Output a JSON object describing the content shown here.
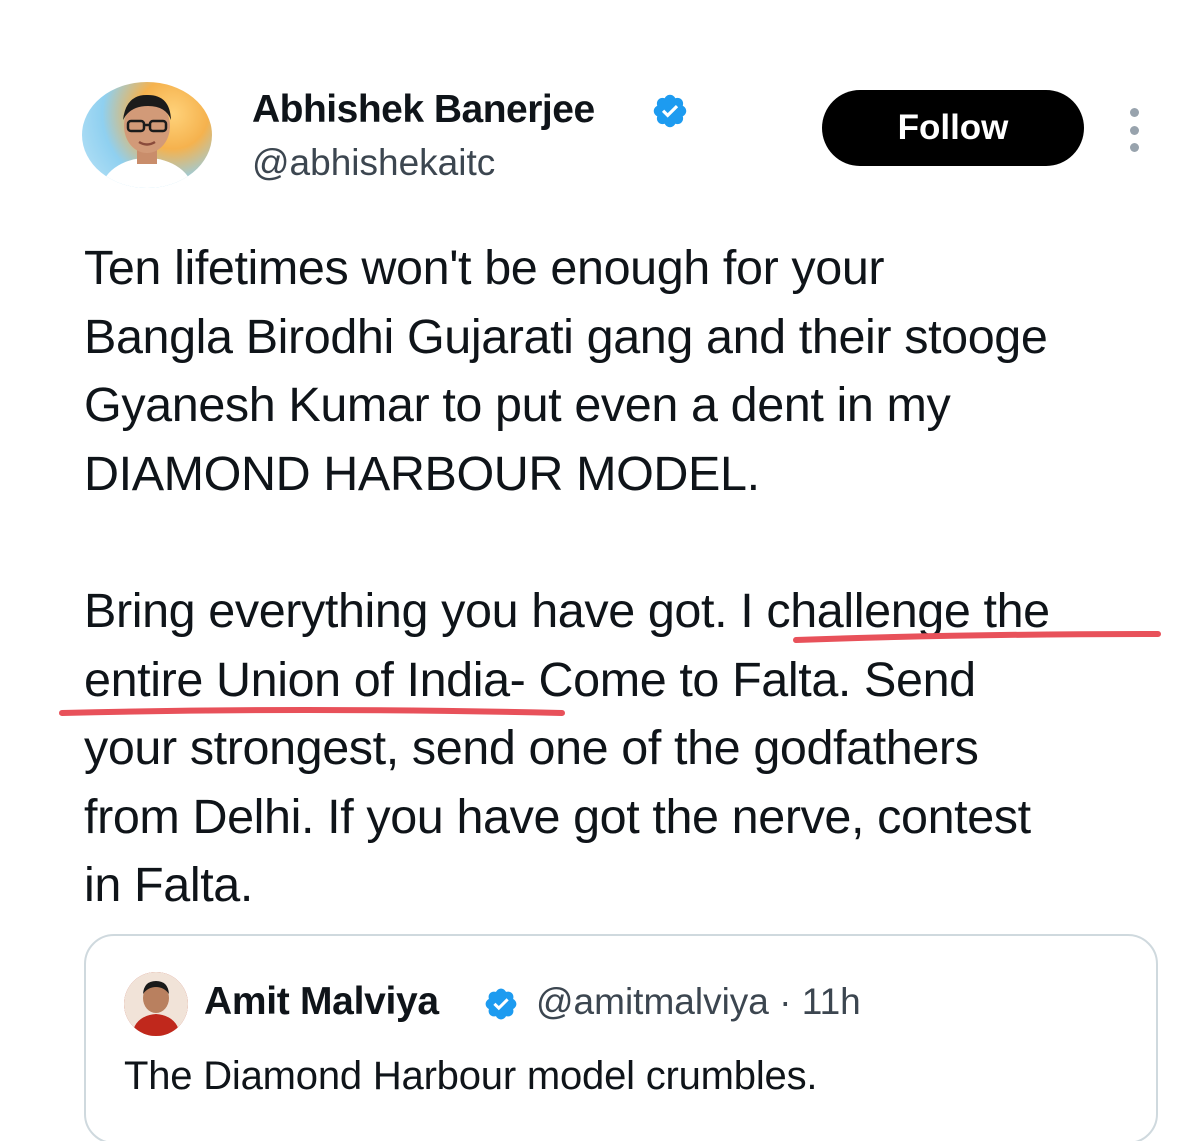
{
  "tweet": {
    "author": {
      "name": "Abhishek Banerjee",
      "handle": "@abhishekaitc",
      "avatar_icon": "profile-photo",
      "verified_icon": "verified-badge-icon"
    },
    "follow_label": "Follow",
    "more_icon": "more-options-icon",
    "body": {
      "paragraph1": [
        "Ten lifetimes won't be enough for your",
        "Bangla Birodhi Gujarati gang and their stooge",
        "Gyanesh Kumar to put even a dent in my",
        "DIAMOND HARBOUR MODEL."
      ],
      "paragraph2": [
        "Bring everything you have got. I challenge the",
        "entire Union of India- Come to Falta. Send",
        "your strongest, send one of the godfathers",
        "from Delhi. If you have got the nerve, contest",
        "in Falta."
      ]
    },
    "highlight_color": "#e8515a",
    "quoted": {
      "name": "Amit Malviya",
      "meta": "@amitmalviya · 11h",
      "text": "The Diamond Harbour model crumbles.",
      "verified_icon": "verified-badge-icon"
    }
  },
  "colors": {
    "text": "#0f1419",
    "secondary_text": "#3c4650",
    "verified": "#1d9bf0",
    "button_bg": "#000000",
    "button_text": "#ffffff",
    "card_border": "#cfd9de"
  }
}
